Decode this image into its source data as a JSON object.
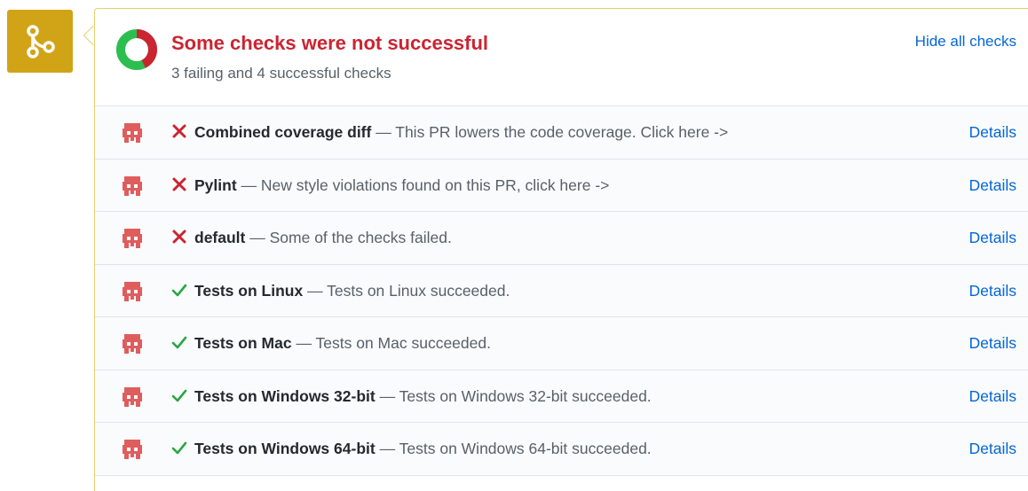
{
  "summary": {
    "title": "Some checks were not successful",
    "subtitle": "3 failing and 4 successful checks",
    "toggle_label": "Hide all checks",
    "failing_count": 3,
    "successful_count": 4
  },
  "colors": {
    "merge_badge": "#d1a417",
    "fail": "#cb2431",
    "success": "#28a745",
    "link": "#0366d6",
    "avatar": "#d9534f"
  },
  "checks": [
    {
      "status": "failure",
      "status_icon": "x-icon",
      "name": "Combined coverage diff",
      "description": "— This PR lowers the code coverage. Click here ->",
      "details_label": "Details"
    },
    {
      "status": "failure",
      "status_icon": "x-icon",
      "name": "Pylint",
      "description": "— New style violations found on this PR, click here ->",
      "details_label": "Details"
    },
    {
      "status": "failure",
      "status_icon": "x-icon",
      "name": "default",
      "description": "— Some of the checks failed.",
      "details_label": "Details"
    },
    {
      "status": "success",
      "status_icon": "check-icon",
      "name": "Tests on Linux",
      "description": "— Tests on Linux succeeded.",
      "details_label": "Details"
    },
    {
      "status": "success",
      "status_icon": "check-icon",
      "name": "Tests on Mac",
      "description": "— Tests on Mac succeeded.",
      "details_label": "Details"
    },
    {
      "status": "success",
      "status_icon": "check-icon",
      "name": "Tests on Windows 32-bit",
      "description": "— Tests on Windows 32-bit succeeded.",
      "details_label": "Details"
    },
    {
      "status": "success",
      "status_icon": "check-icon",
      "name": "Tests on Windows 64-bit",
      "description": "— Tests on Windows 64-bit succeeded.",
      "details_label": "Details"
    }
  ]
}
